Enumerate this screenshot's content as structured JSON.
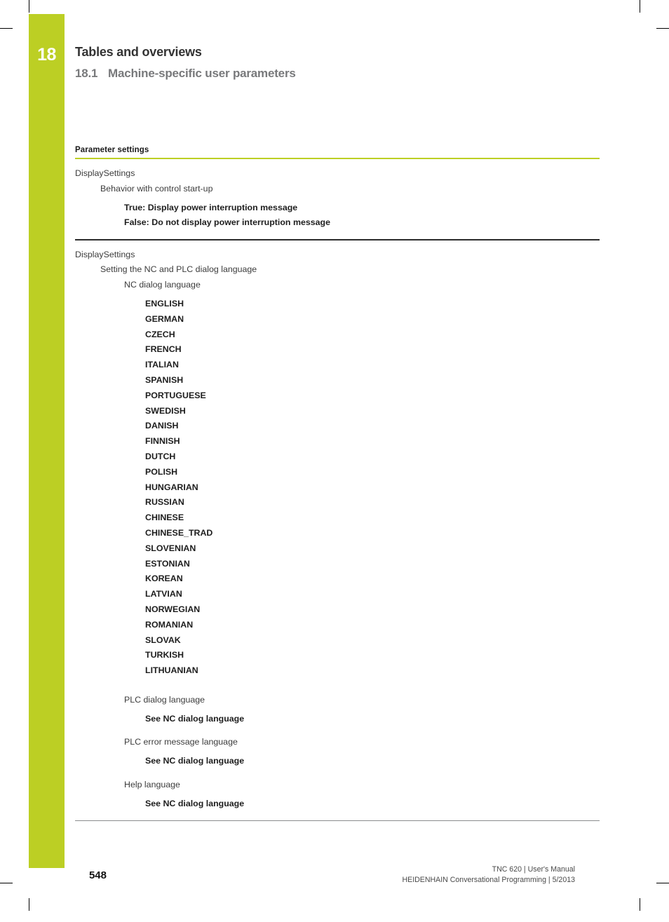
{
  "chapter": {
    "number": "18",
    "title": "Tables and overviews",
    "section_number": "18.1",
    "section_title": "Machine-specific user parameters"
  },
  "colors": {
    "accent": "#bccf24",
    "heading_gray": "#78797b",
    "text": "#3c3c3c",
    "rule_dark": "#2b2b2b",
    "rule_gray": "#8a8c8e"
  },
  "table": {
    "header": "Parameter settings",
    "sections": [
      {
        "group": "DisplaySettings",
        "parameter": "Behavior with control start-up",
        "values": [
          "True: Display power interruption message",
          "False: Do not display power interruption message"
        ]
      },
      {
        "group": "DisplaySettings",
        "parameter": "Setting the NC and PLC dialog language",
        "entries": [
          {
            "name": "NC dialog language",
            "values": [
              "ENGLISH",
              "GERMAN",
              "CZECH",
              "FRENCH",
              "ITALIAN",
              "SPANISH",
              "PORTUGUESE",
              "SWEDISH",
              "DANISH",
              "FINNISH",
              "DUTCH",
              "POLISH",
              "HUNGARIAN",
              "RUSSIAN",
              "CHINESE",
              "CHINESE_TRAD",
              "SLOVENIAN",
              "ESTONIAN",
              "KOREAN",
              "LATVIAN",
              "NORWEGIAN",
              "ROMANIAN",
              "SLOVAK",
              "TURKISH",
              "LITHUANIAN"
            ]
          },
          {
            "name": "PLC dialog language",
            "values": [
              "See NC dialog language"
            ]
          },
          {
            "name": "PLC error message language",
            "values": [
              "See NC dialog language"
            ]
          },
          {
            "name": "Help language",
            "values": [
              "See NC dialog language"
            ]
          }
        ]
      }
    ]
  },
  "footer": {
    "page_number": "548",
    "line1": "TNC 620 | User's Manual",
    "line2": "HEIDENHAIN Conversational Programming | 5/2013"
  }
}
